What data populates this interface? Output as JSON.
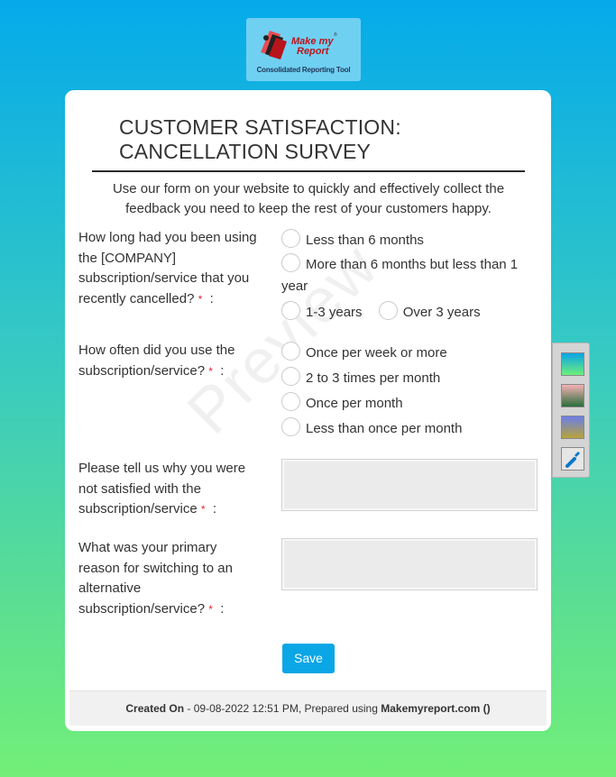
{
  "logo": {
    "line1": "Make my",
    "line2": "Report",
    "tm": "®",
    "tagline": "Consolidated Reporting Tool"
  },
  "watermark": "Preview",
  "form": {
    "title": "CUSTOMER SATISFACTION: CANCELLATION SURVEY",
    "intro": "Use our form on your website to quickly and effectively collect the feedback you need to keep the rest of your customers happy.",
    "required_mark": "*",
    "questions": [
      {
        "label": "How long had you been using the [COMPANY] subscription/service that you recently cancelled?",
        "suffix": ":",
        "options": [
          "Less than 6 months",
          "More than 6 months but less than 1 year",
          "1-3 years",
          "Over 3 years"
        ]
      },
      {
        "label": "How often did you use the subscription/service?",
        "suffix": ":",
        "options": [
          "Once per week or more",
          "2 to 3 times per month",
          "Once per month",
          "Less than once per month"
        ]
      },
      {
        "label": "Please tell us why you were not satisfied with the subscription/service",
        "suffix": ":"
      },
      {
        "label": "What was your primary reason for switching to an alternative subscription/service?",
        "suffix": ":"
      }
    ],
    "save_label": "Save"
  },
  "footer": {
    "created_label": "Created On",
    "created_text": " - 09-08-2022 12:51 PM, Prepared using ",
    "brand": "Makemyreport.com ()"
  },
  "colors": {
    "accent": "#0ba6e6",
    "required": "#e0262b"
  }
}
